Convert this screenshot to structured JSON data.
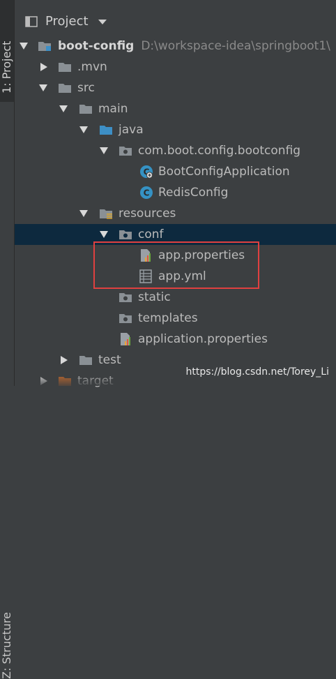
{
  "side": {
    "project_tab": "1: Project",
    "structure_tab": "Z: Structure"
  },
  "header": {
    "title": "Project"
  },
  "tree": {
    "root": {
      "name": "boot-config",
      "path": "D:\\workspace-idea\\springboot1\\"
    },
    "mvn": ".mvn",
    "src": "src",
    "main": "main",
    "java": "java",
    "package": "com.boot.config.bootconfig",
    "class_app": "BootConfigApplication",
    "class_redis": "RedisConfig",
    "resources": "resources",
    "conf": "conf",
    "app_properties": "app.properties",
    "app_yml": "app.yml",
    "static": "static",
    "templates": "templates",
    "application_properties": "application.properties",
    "test": "test",
    "target": "target"
  },
  "watermark": "https://blog.csdn.net/Torey_Li",
  "colors": {
    "background": "#3c3f41",
    "selection": "#0d293e",
    "highlight": "#e04040",
    "folder": "#8a9095",
    "source_folder": "#3d8fc6",
    "class_icon": "#3592c4",
    "target_folder": "#c2692d"
  }
}
